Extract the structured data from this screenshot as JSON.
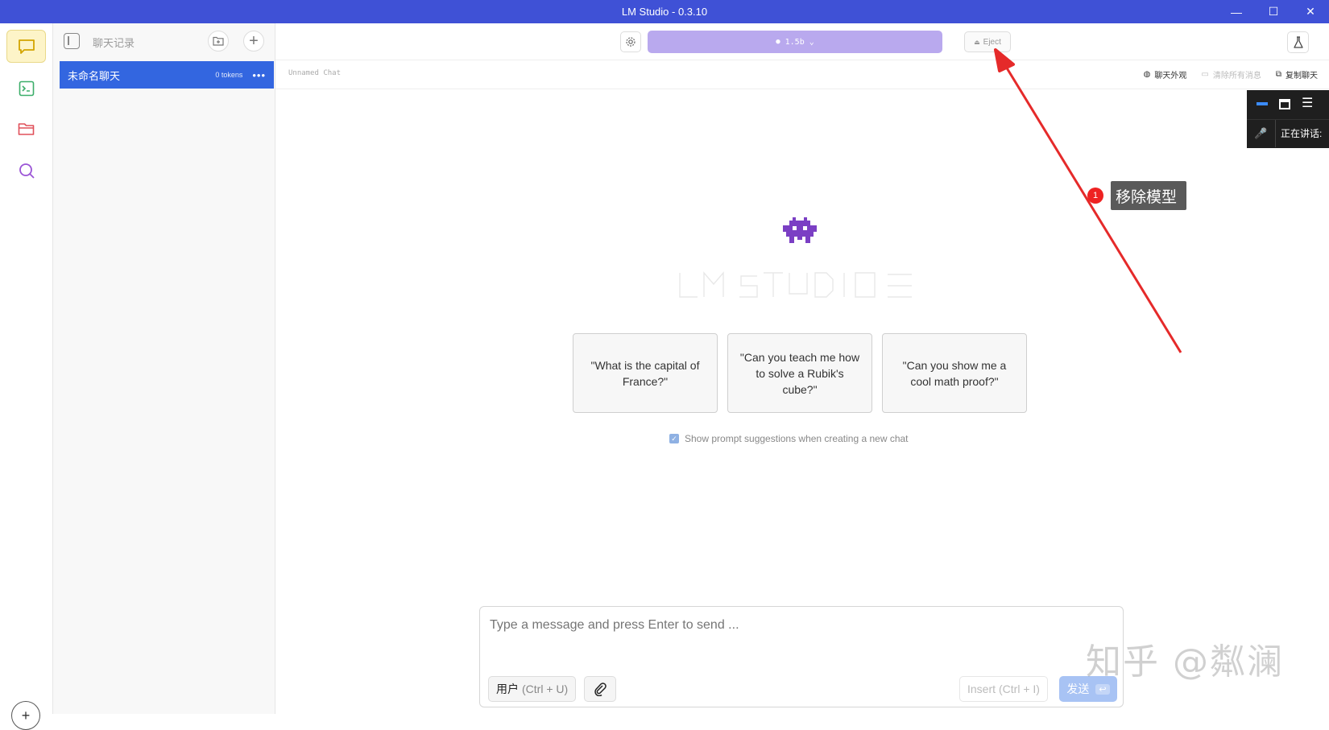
{
  "window": {
    "title": "LM Studio - 0.3.10",
    "minimize": "—",
    "maximize": "☐",
    "close": "✕"
  },
  "chat_list": {
    "title": "聊天记录",
    "items": [
      {
        "name": "未命名聊天",
        "tokens": "0 tokens",
        "more": "•••"
      }
    ]
  },
  "topbar": {
    "model_label": "1.5b",
    "eject_label": "Eject"
  },
  "subbar": {
    "chat_name": "Unnamed Chat",
    "appearance": "聊天外观",
    "clear_all": "清除所有消息",
    "copy_chat": "复制聊天"
  },
  "welcome": {
    "suggestions": [
      "\"What is the capital of France?\"",
      "\"Can you teach me how to solve a Rubik's cube?\"",
      "\"Can you show me a cool math proof?\""
    ],
    "show_suggestions_label": "Show prompt suggestions when creating a new chat",
    "show_suggestions_checked": true
  },
  "composer": {
    "placeholder": "Type a message and press Enter to send ...",
    "role_label": "用户",
    "role_hint": "(Ctrl + U)",
    "insert_label": "Insert",
    "insert_hint": "(Ctrl + I)",
    "send_label": "发送",
    "send_key": "↩"
  },
  "overlay": {
    "speaking_label": "正在讲话:"
  },
  "annotation": {
    "number": "1",
    "label": "移除模型"
  },
  "watermark": "知乎 @粼澜",
  "colors": {
    "titlebar": "#3f51d6",
    "active_chat": "#3366e0",
    "model_button": "#b9a9ee",
    "arrow": "#e52a2a"
  }
}
